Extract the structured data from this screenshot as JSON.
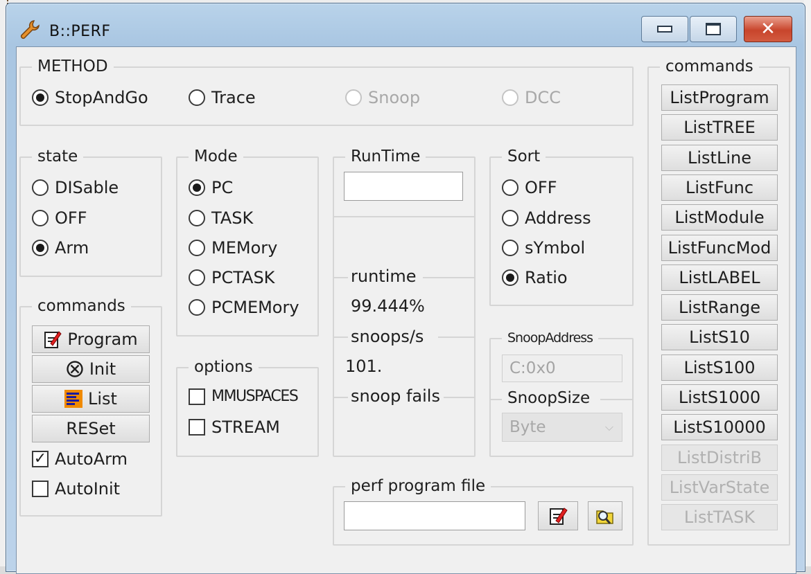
{
  "window": {
    "title": "B::PERF",
    "icon": "wrench-icon",
    "controls": {
      "minimize": "minimize-icon",
      "maximize": "maximize-icon",
      "close": "close-icon"
    }
  },
  "method": {
    "legend": "METHOD",
    "options": [
      {
        "label": "StopAndGo",
        "selected": true,
        "enabled": true
      },
      {
        "label": "Trace",
        "selected": false,
        "enabled": true
      },
      {
        "label": "Snoop",
        "selected": false,
        "enabled": false
      },
      {
        "label": "DCC",
        "selected": false,
        "enabled": false
      }
    ]
  },
  "state": {
    "legend": "state",
    "options": [
      {
        "label": "DISable",
        "selected": false
      },
      {
        "label": "OFF",
        "selected": false
      },
      {
        "label": "Arm",
        "selected": true
      }
    ]
  },
  "mode": {
    "legend": "Mode",
    "options": [
      {
        "label": "PC",
        "selected": true
      },
      {
        "label": "TASK",
        "selected": false
      },
      {
        "label": "MEMory",
        "selected": false
      },
      {
        "label": "PCTASK",
        "selected": false
      },
      {
        "label": "PCMEMory",
        "selected": false
      }
    ]
  },
  "runtime": {
    "legend": "RunTime",
    "field_value": "",
    "runtime_label": "runtime",
    "runtime_value": "99.444%",
    "snoops_label": "snoops/s",
    "snoops_value": "101.",
    "snoop_fails_label": "snoop fails",
    "snoop_fails_value": ""
  },
  "sort": {
    "legend": "Sort",
    "options": [
      {
        "label": "OFF",
        "selected": false
      },
      {
        "label": "Address",
        "selected": false
      },
      {
        "label": "sYmbol",
        "selected": false
      },
      {
        "label": "Ratio",
        "selected": true
      }
    ]
  },
  "left_commands": {
    "legend": "commands",
    "program": "Program",
    "init": "Init",
    "list": "List",
    "reset": "RESet",
    "autoarm": {
      "label": "AutoArm",
      "checked": true
    },
    "autoinit": {
      "label": "AutoInit",
      "checked": false
    }
  },
  "options": {
    "legend": "options",
    "items": [
      {
        "label": "MMUSPACES",
        "checked": false
      },
      {
        "label": "STREAM",
        "checked": false
      }
    ]
  },
  "snoop": {
    "address_legend": "SnoopAddress",
    "address_value": "C:0x0",
    "size_legend": "SnoopSize",
    "size_value": "Byte"
  },
  "perf_file": {
    "legend": "perf program file",
    "value": ""
  },
  "right_commands": {
    "legend": "commands",
    "items": [
      {
        "label": "ListProgram",
        "enabled": true
      },
      {
        "label": "ListTREE",
        "enabled": true
      },
      {
        "label": "ListLine",
        "enabled": true
      },
      {
        "label": "ListFunc",
        "enabled": true
      },
      {
        "label": "ListModule",
        "enabled": true
      },
      {
        "label": "ListFuncMod",
        "enabled": true
      },
      {
        "label": "ListLABEL",
        "enabled": true
      },
      {
        "label": "ListRange",
        "enabled": true
      },
      {
        "label": "ListS10",
        "enabled": true
      },
      {
        "label": "ListS100",
        "enabled": true
      },
      {
        "label": "ListS1000",
        "enabled": true
      },
      {
        "label": "ListS10000",
        "enabled": true
      },
      {
        "label": "ListDistriB",
        "enabled": false
      },
      {
        "label": "ListVarState",
        "enabled": false
      },
      {
        "label": "ListTASK",
        "enabled": false
      }
    ]
  }
}
